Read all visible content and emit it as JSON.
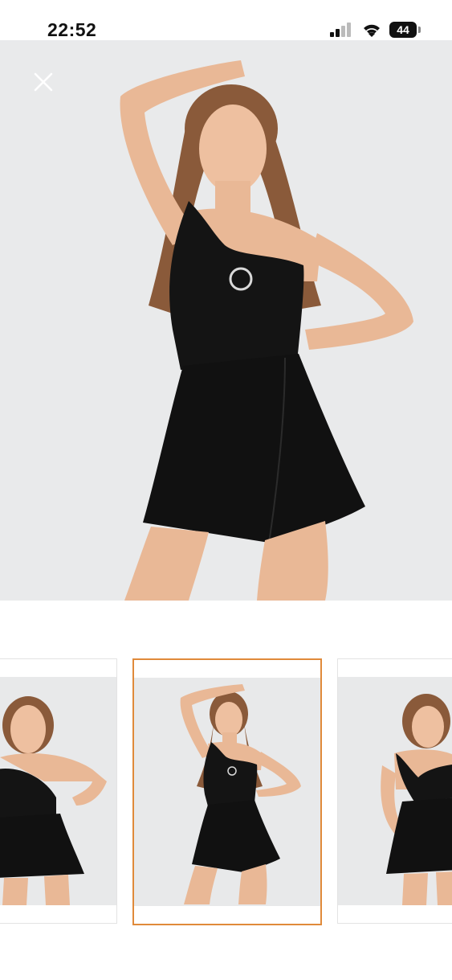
{
  "status_bar": {
    "time": "22:52",
    "battery_level": "44",
    "icons": [
      "signal-icon",
      "wifi-icon",
      "battery-icon"
    ]
  },
  "viewer": {
    "close_icon": "close-icon",
    "selected_index": 1,
    "colors": {
      "accent": "#e08a3a",
      "background": "#e9eaeb",
      "garment": "#111111",
      "skin": "#e9b896",
      "hair": "#8a5a3a"
    }
  },
  "thumbnails": [
    {
      "icon": "model-photo-1"
    },
    {
      "icon": "model-photo-2"
    },
    {
      "icon": "model-photo-3"
    }
  ]
}
